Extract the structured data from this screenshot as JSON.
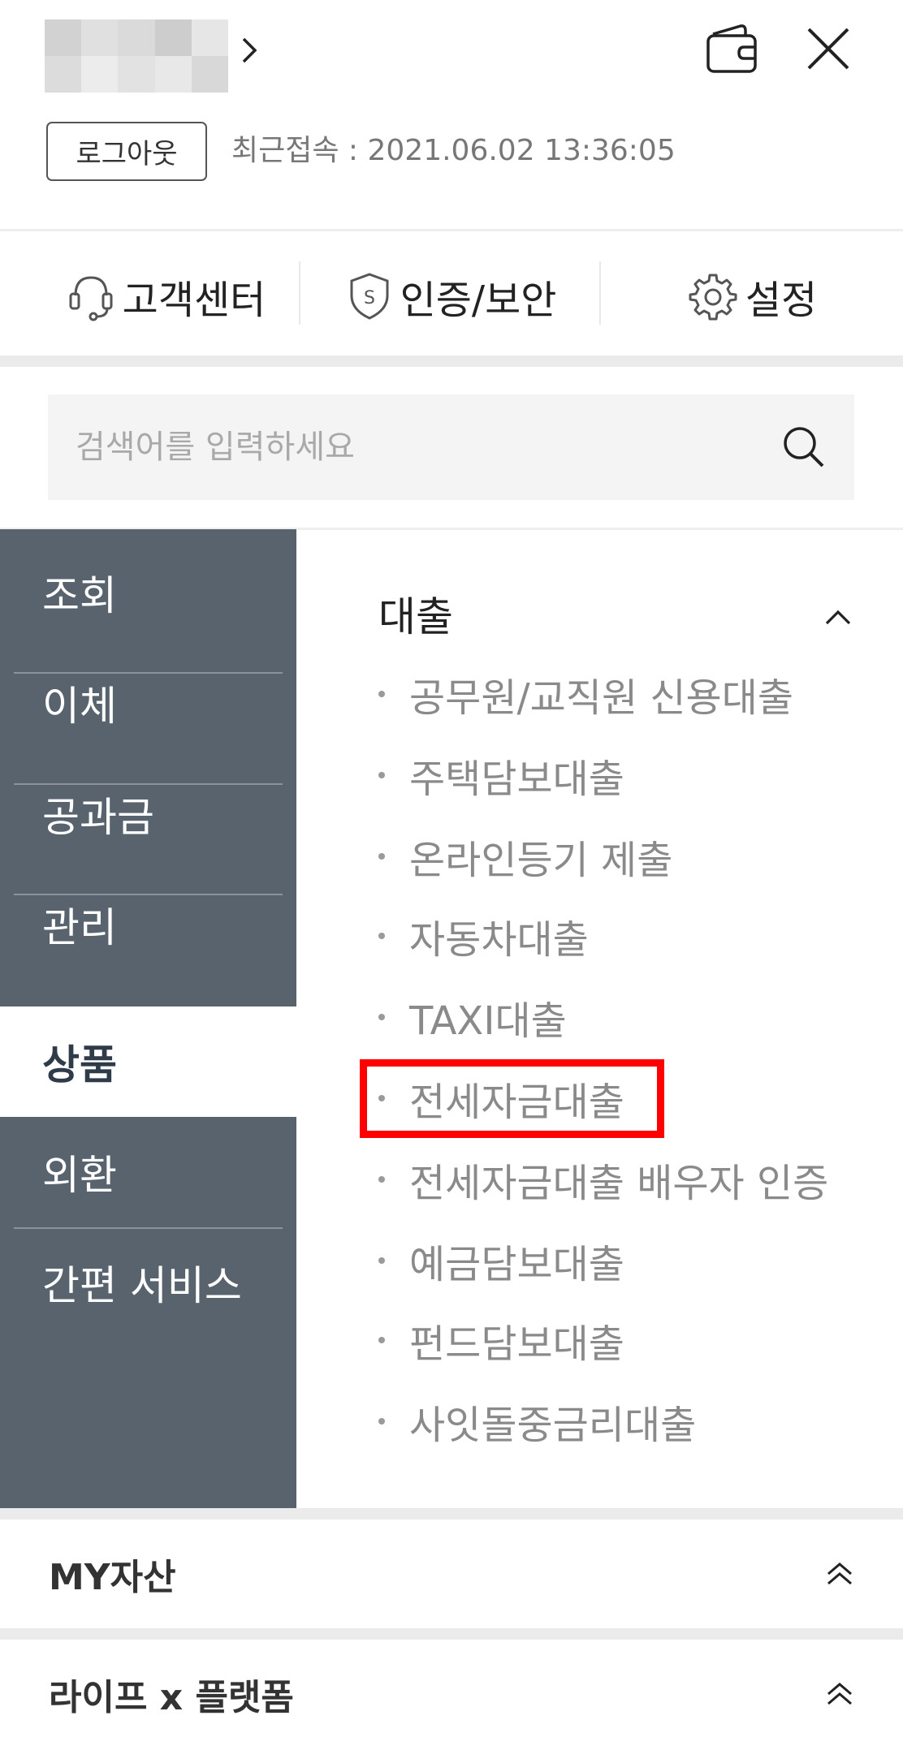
{
  "header": {
    "logout_label": "로그아웃",
    "last_login": "최근접속 : 2021.06.02 13:36:05",
    "chevron": "›"
  },
  "quick_menu": [
    {
      "label": "고객센터",
      "icon": "headset-icon"
    },
    {
      "label": "인증/보안",
      "icon": "shield-icon"
    },
    {
      "label": "설정",
      "icon": "gear-icon"
    }
  ],
  "search": {
    "placeholder": "검색어를 입력하세요"
  },
  "side_nav": {
    "items": [
      {
        "label": "조회"
      },
      {
        "label": "이체"
      },
      {
        "label": "공과금"
      },
      {
        "label": "관리"
      },
      {
        "label": "상품",
        "active": true
      },
      {
        "label": "외환"
      },
      {
        "label": "간편 서비스"
      }
    ]
  },
  "content": {
    "section_title": "대출",
    "items": [
      "공무원/교직원 신용대출",
      "주택담보대출",
      "온라인등기 제출",
      "자동차대출",
      "TAXI대출",
      "전세자금대출",
      "전세자금대출 배우자 인증",
      "예금담보대출",
      "펀드담보대출",
      "사잇돌중금리대출"
    ],
    "highlighted_index": 5,
    "highlight_color": "#ff0000"
  },
  "bottom_sections": [
    {
      "label": "MY자산"
    },
    {
      "label": "라이프 x 플랫폼"
    }
  ],
  "colors": {
    "nav_bg": "#58636e",
    "active_text": "#2f3b49"
  }
}
